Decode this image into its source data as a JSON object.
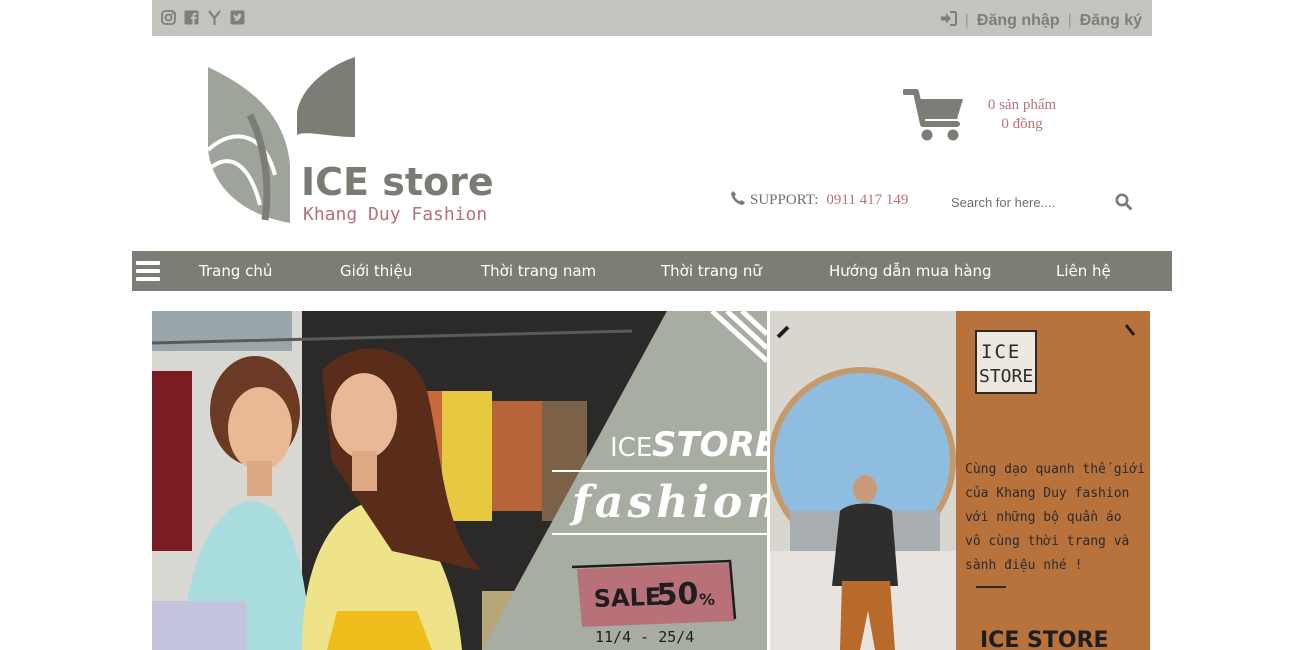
{
  "topbar": {
    "social_icons": [
      "instagram-icon",
      "facebook-icon",
      "yandex-icon",
      "twitter-icon"
    ],
    "login_label": "Đăng nhập",
    "register_label": "Đăng ký",
    "separator": "|"
  },
  "logo": {
    "title": "ICE store",
    "subtitle": "Khang Duy Fashion"
  },
  "cart": {
    "count_text": "0 sản phẩm",
    "total_text": "0 đồng"
  },
  "support": {
    "label": "SUPPORT:",
    "phone": "0911 417 149"
  },
  "search": {
    "placeholder": "Search for here...."
  },
  "nav": {
    "items": [
      "Trang chủ",
      "Giới thiệu",
      "Thời trang nam",
      "Thời trang nữ",
      "Hướng dẫn mua hàng",
      "Liên hệ"
    ]
  },
  "banner_left": {
    "brand_light": "ICE",
    "brand_bold": "STORE",
    "tagline": "fashion",
    "sale_label": "SALE",
    "sale_value": "50",
    "sale_unit": "%",
    "dates": "11/4 - 25/4"
  },
  "banner_right": {
    "badge_line1": "ICE",
    "badge_line2": "STORE",
    "text_lines": [
      "Cùng dạo quanh thế giới",
      "của Khang Duy fashion",
      "với những bộ quần áo",
      "vô cùng thời trang và",
      "sành điệu nhé !"
    ],
    "footer": "ICE STORE"
  },
  "colors": {
    "topbar_bg": "#c1c5bd",
    "nav_bg": "#7c7e76",
    "accent_pink": "#b97179",
    "brand_gray": "#7a7c74",
    "banner_orange": "#b8723c"
  }
}
